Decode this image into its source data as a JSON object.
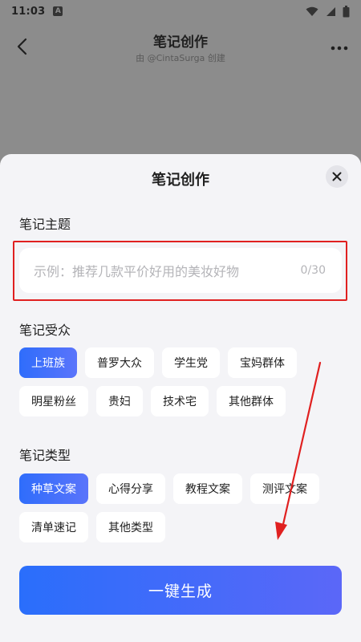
{
  "status_bar": {
    "time": "11:03",
    "notification_icon": "a-icon"
  },
  "header": {
    "title": "笔记创作",
    "subtitle": "由 @CintaSurga 创建"
  },
  "sheet": {
    "title": "笔记创作",
    "topic": {
      "label": "笔记主题",
      "value": "",
      "placeholder": "示例：推荐几款平价好用的美妆好物",
      "counter": "0/30"
    },
    "audience": {
      "label": "笔记受众",
      "options": [
        "上班族",
        "普罗大众",
        "学生党",
        "宝妈群体",
        "明星粉丝",
        "贵妇",
        "技术宅",
        "其他群体"
      ],
      "selected": "上班族"
    },
    "type": {
      "label": "笔记类型",
      "options": [
        "种草文案",
        "心得分享",
        "教程文案",
        "测评文案",
        "清单速记",
        "其他类型"
      ],
      "selected": "种草文案"
    },
    "generate_label": "一键生成"
  },
  "colors": {
    "accent_start": "#2f6dfb",
    "accent_end": "#5b67f8",
    "highlight_red": "#e02020",
    "overlay": "#8c8c8c"
  }
}
